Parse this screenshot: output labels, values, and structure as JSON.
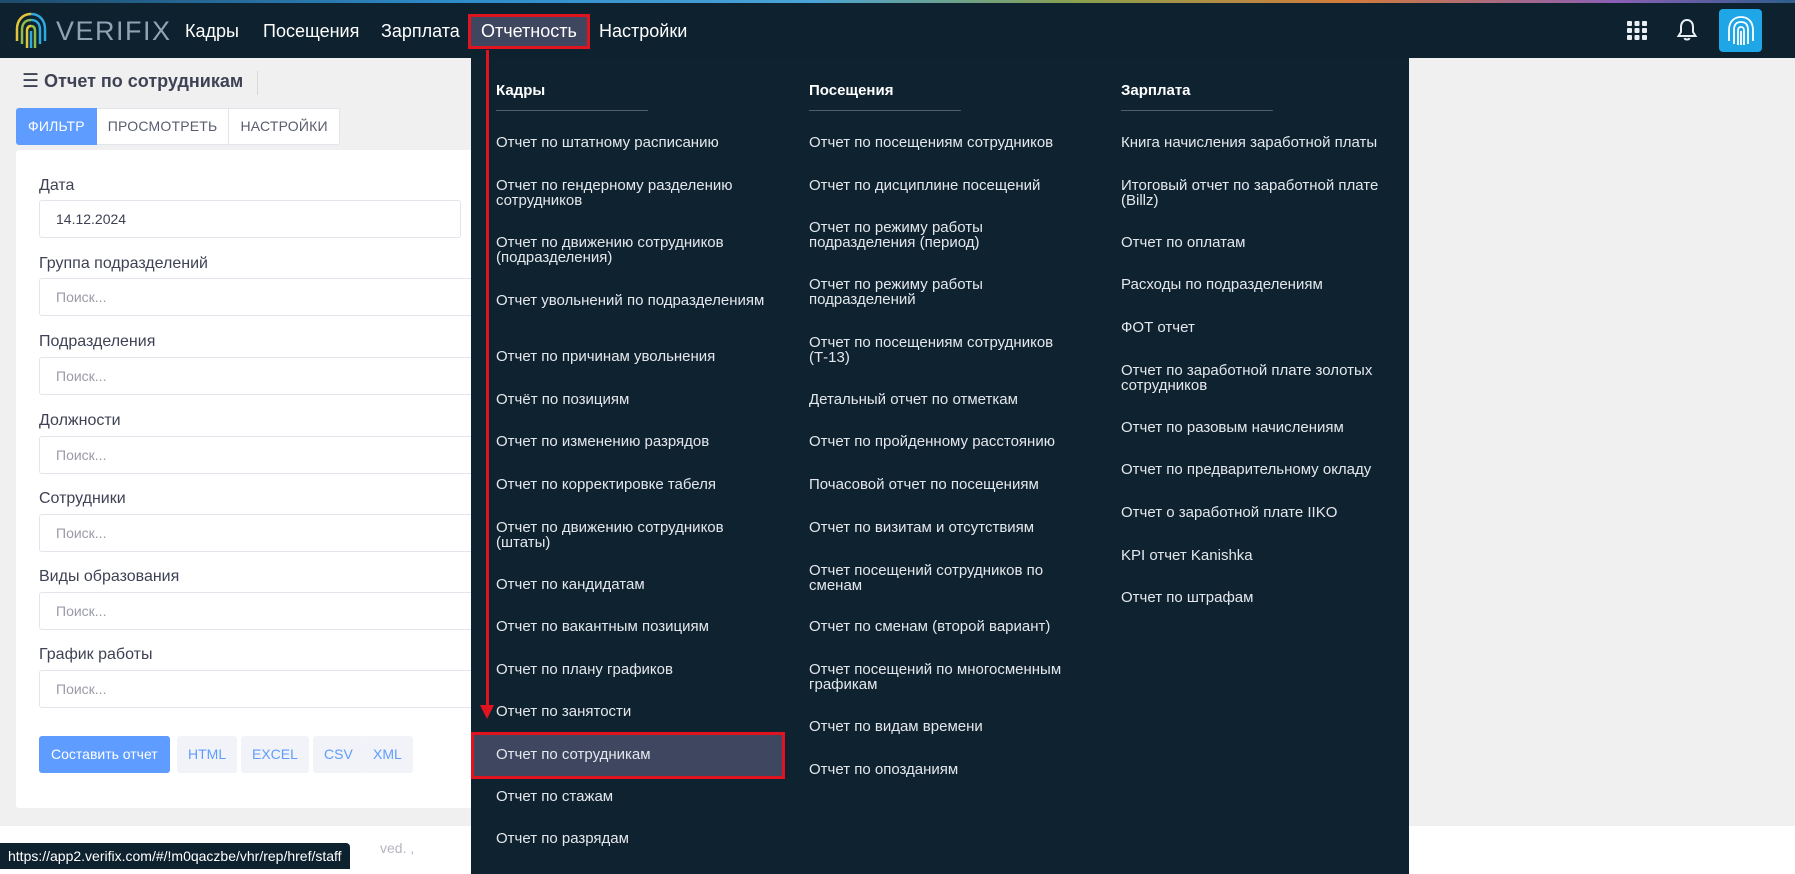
{
  "brand": {
    "name": "VERIFIX"
  },
  "nav": {
    "items": [
      "Кадры",
      "Посещения",
      "Зарплата",
      "Отчетность",
      "Настройки"
    ],
    "active": "Отчетность"
  },
  "page": {
    "title": "Отчет по сотрудникам",
    "tabs": [
      "ФИЛЬТР",
      "ПРОСМОТРЕТЬ",
      "НАСТРОЙКИ"
    ],
    "active_tab": "ФИЛЬТР"
  },
  "filter": {
    "date_label": "Дата",
    "date_value": "14.12.2024",
    "fields": [
      {
        "label": "Группа подразделений",
        "placeholder": "Поиск..."
      },
      {
        "label": "Подразделения",
        "placeholder": "Поиск..."
      },
      {
        "label": "Должности",
        "placeholder": "Поиск..."
      },
      {
        "label": "Сотрудники",
        "placeholder": "Поиск..."
      },
      {
        "label": "Виды образования",
        "placeholder": "Поиск..."
      },
      {
        "label": "График работы",
        "placeholder": "Поиск..."
      }
    ],
    "actions": {
      "build": "Составить отчет",
      "html": "HTML",
      "excel": "EXCEL",
      "csv": "CSV",
      "xml": "XML"
    }
  },
  "menu": {
    "columns": [
      {
        "title": "Кадры",
        "items": [
          "Отчет по штатному расписанию",
          "Отчет по гендерному разделению сотрудников",
          "Отчет по движению сотрудников (подразделения)",
          "Отчет увольнений по подразделениям",
          "Отчет по причинам увольнения",
          "Отчёт по позициям",
          "Отчет по изменению разрядов",
          "Отчет по корректировке табеля",
          "Отчет по движению сотрудников (штаты)",
          "Отчет по кандидатам",
          "Отчет по вакантным позициям",
          "Отчет по плану графиков",
          "Отчет по занятости",
          "Отчет по сотрудникам",
          "Отчет по стажам",
          "Отчет по разрядам"
        ]
      },
      {
        "title": "Посещения",
        "items": [
          "Отчет по посещениям сотрудников",
          "Отчет по дисциплине посещений",
          "Отчет по режиму работы подразделения (период)",
          "Отчет по режиму работы подразделений",
          "Отчет по посещениям сотрудников (Т-13)",
          "Детальный отчет по отметкам",
          "Отчет по пройденному расстоянию",
          "Почасовой отчет по посещениям",
          "Отчет по визитам и отсутствиям",
          "Отчет посещений сотрудников по сменам",
          "Отчет по сменам (второй вариант)",
          "Отчет посещений по многосменным графикам",
          "Отчет по видам времени",
          "Отчет по опозданиям"
        ]
      },
      {
        "title": "Зарплата",
        "items": [
          "Книга начисления заработной платы",
          "Итоговый отчет по заработной плате (Billz)",
          "Отчет по оплатам",
          "Расходы по подразделениям",
          "ФОТ отчет",
          "Отчет по заработной плате золотых сотрудников",
          "Отчет по разовым начислениям",
          "Отчет по предварительному окладу",
          "Отчет о заработной плате IIKO",
          "KPI отчет Kanishka",
          "Отчет по штрафам"
        ]
      }
    ],
    "selected": "Отчет по сотрудникам"
  },
  "footer": {
    "text": "ved. ,"
  },
  "status_url": "https://app2.verifix.com/#/!m0qaczbe/vhr/rep/href/staff",
  "colors": {
    "navbar": "#0d212f",
    "accent": "#5e9cff",
    "highlight": "#e0141e",
    "menu_bg": "#0f2230"
  }
}
